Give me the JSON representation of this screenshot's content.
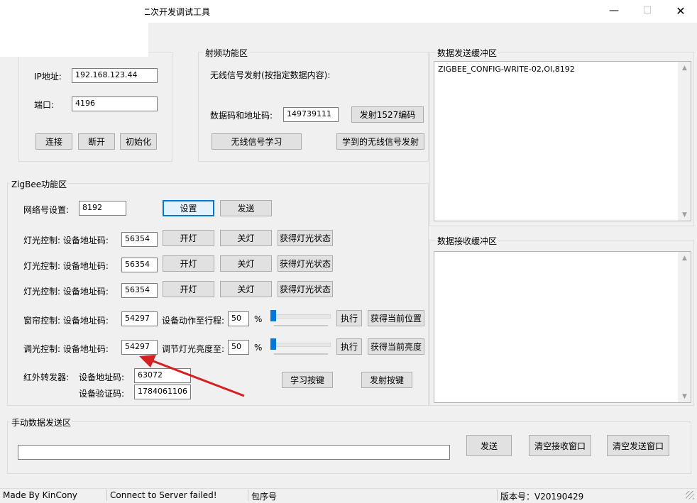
{
  "window": {
    "title": "二次开发调试工具",
    "min": "—",
    "max": "☐",
    "close": "✕"
  },
  "network": {
    "ip_label": "IP地址:",
    "ip_value": "192.168.123.44",
    "port_label": "端口:",
    "port_value": "4196",
    "connect": "连接",
    "disconnect": "断开",
    "init": "初始化"
  },
  "rf": {
    "group": "射频功能区",
    "desc": "无线信号发射(按指定数据内容):",
    "code_label": "数据码和地址码:",
    "code_value": "149739111",
    "send1527": "发射1527编码",
    "learn": "无线信号学习",
    "send_learned": "学到的无线信号发射"
  },
  "zigbee": {
    "group": "ZigBee功能区",
    "net_label": "网络号设置:",
    "net_value": "8192",
    "set": "设置",
    "send": "发送",
    "lights": [
      {
        "label": "灯光控制: 设备地址码:",
        "addr": "56354",
        "on": "开灯",
        "off": "关灯",
        "status": "获得灯光状态"
      },
      {
        "label": "灯光控制: 设备地址码:",
        "addr": "56354",
        "on": "开灯",
        "off": "关灯",
        "status": "获得灯光状态"
      },
      {
        "label": "灯光控制: 设备地址码:",
        "addr": "56354",
        "on": "开灯",
        "off": "关灯",
        "status": "获得灯光状态"
      }
    ],
    "curtain": {
      "label": "窗帘控制: 设备地址码:",
      "addr": "54297",
      "action_label": "设备动作至行程:",
      "value": "50",
      "unit": "%",
      "exec": "执行",
      "get": "获得当前位置"
    },
    "dimmer": {
      "label": "调光控制: 设备地址码:",
      "addr": "54297",
      "action_label": "调节灯光亮度至:",
      "value": "50",
      "unit": "%",
      "exec": "执行",
      "get": "获得当前亮度"
    },
    "ir": {
      "label": "红外转发器:",
      "addr_label": "设备地址码:",
      "addr": "63072",
      "verify_label": "设备验证码:",
      "verify": "1784061106",
      "learn": "学习按键",
      "send": "发射按键"
    }
  },
  "send_buffer": {
    "group": "数据发送缓冲区",
    "content": "ZIGBEE_CONFIG-WRITE-02,OI,8192"
  },
  "recv_buffer": {
    "group": "数据接收缓冲区",
    "content": ""
  },
  "manual": {
    "group": "手动数据发送区",
    "input_value": "",
    "send": "发送",
    "clear_recv": "清空接收窗口",
    "clear_send": "清空发送窗口"
  },
  "status": {
    "made_by": "Made By KinCony",
    "connection": "Connect to Server failed!",
    "seq": "包序号",
    "version": "版本号：V20190429"
  },
  "colors": {
    "accent": "#0078d7",
    "arrow": "#d42020"
  }
}
